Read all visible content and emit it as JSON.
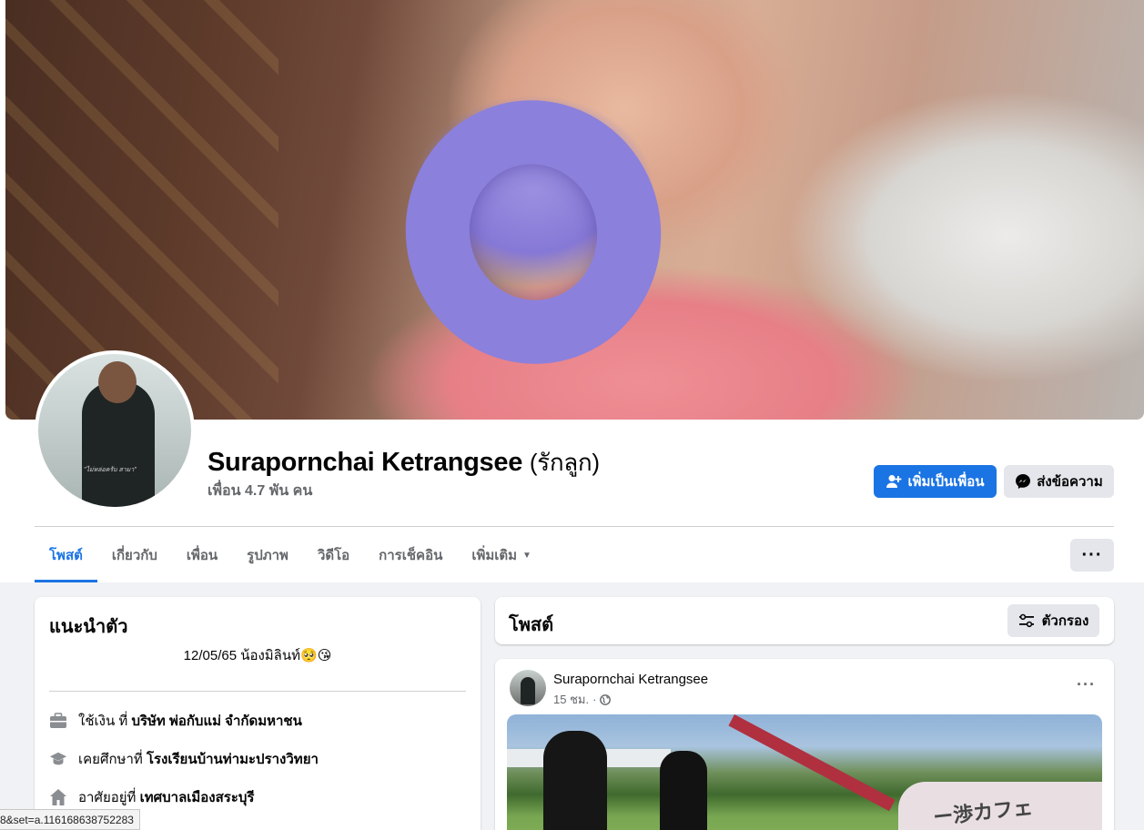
{
  "profile": {
    "name": "Surapornchai Ketrangsee",
    "alt_name": "(รักลูก)",
    "friends": "เพื่อน 4.7 พัน คน",
    "avatar_caption": "\"ไม่หล่อครับ สามา\""
  },
  "actions": {
    "add_friend": "เพิ่มเป็นเพื่อน",
    "message": "ส่งข้อความ"
  },
  "tabs": [
    {
      "label": "โพสต์",
      "active": true
    },
    {
      "label": "เกี่ยวกับ"
    },
    {
      "label": "เพื่อน"
    },
    {
      "label": "รูปภาพ"
    },
    {
      "label": "วิดีโอ"
    },
    {
      "label": "การเช็คอิน"
    },
    {
      "label": "เพิ่มเติม"
    }
  ],
  "more_menu": "···",
  "intro": {
    "title": "แนะนำตัว",
    "bio": "12/05/65 น้องมิลินท์🥺😘",
    "work_prefix": "ใช้เงิน ที่",
    "work_place": "บริษัท พ่อกับแม่ จำกัดมหาชน",
    "study_prefix": "เคยศึกษาที่",
    "study_place": "โรงเรียนบ้านท่ามะปรางวิทยา",
    "home_prefix": "อาศัยอยู่ที่",
    "home_place": "เทศบาลเมืองสระบุรี"
  },
  "posts": {
    "title": "โพสต์",
    "filter": "ตัวกรอง",
    "items": [
      {
        "author": "Surapornchai Ketrangsee",
        "time": "15 ชม.",
        "separator": "·",
        "options": "···",
        "image_text": "ー渉カフェ"
      }
    ]
  },
  "status_bar": {
    "url": "8&set=a.116168638752283"
  },
  "colors": {
    "accent": "#1b74e4",
    "background": "#f0f2f5",
    "secondary_button": "#e4e6eb",
    "muted_text": "#65676b"
  },
  "icons": [
    "add-friend-icon",
    "messenger-icon",
    "caret-down-icon",
    "filter-icon",
    "briefcase-icon",
    "graduation-cap-icon",
    "home-icon",
    "globe-icon"
  ]
}
